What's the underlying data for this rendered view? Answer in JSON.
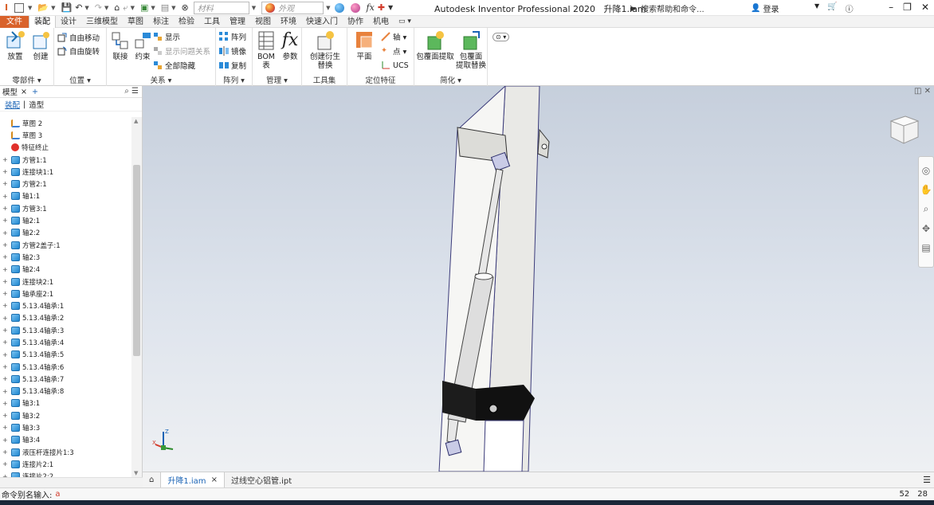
{
  "title_bar": {
    "app_title": "Autodesk Inventor Professional 2020",
    "document": "升降1.iam",
    "material_placeholder": "材料",
    "appearance_placeholder": "外观",
    "search_placeholder": "搜索帮助和命令...",
    "login": "登录"
  },
  "ribbon_tabs": [
    "文件",
    "装配",
    "设计",
    "三维模型",
    "草图",
    "标注",
    "检验",
    "工具",
    "管理",
    "视图",
    "环境",
    "快速入门",
    "协作",
    "机电"
  ],
  "active_tab": "装配",
  "ribbon": {
    "component": {
      "footer": "零部件 ▾",
      "place": "放置",
      "create": "创建"
    },
    "position": {
      "footer": "位置 ▾",
      "free_move": "自由移动",
      "free_rotate": "自由旋转"
    },
    "relationships": {
      "footer": "关系 ▾",
      "join": "联接",
      "constrain": "约束",
      "show": "显示",
      "show_problem": "显示问题关系",
      "hide_all": "全部隐藏"
    },
    "pattern": {
      "footer": "阵列 ▾",
      "pattern": "阵列",
      "mirror": "镜像",
      "copy": "复制"
    },
    "manage": {
      "footer": "管理 ▾",
      "bom_l1": "BOM",
      "bom_l2": "表",
      "params": "参数"
    },
    "productivity": {
      "footer": "工具集",
      "derive_l1": "创建衍生",
      "derive_l2": "替换"
    },
    "work_features": {
      "footer": "定位特征",
      "plane": "平面",
      "axis": "轴 ▾",
      "point": "点 ▾",
      "ucs": "UCS"
    },
    "simplification": {
      "footer": "简化 ▾",
      "shrinkwrap": "包覆面提取",
      "shrinkwrap_sub_l1": "包覆面",
      "shrinkwrap_sub_l2": "提取替换"
    }
  },
  "browser": {
    "header": "模型",
    "close": "×",
    "add": "+",
    "tab_assembly": "装配",
    "tab_modeling": "造型",
    "items": [
      {
        "label": "草图 2",
        "type": "sketch",
        "expand": false
      },
      {
        "label": "草图 3",
        "type": "sketch",
        "expand": false
      },
      {
        "label": "特征终止",
        "type": "stop",
        "expand": false
      },
      {
        "label": "方管1:1",
        "type": "part",
        "expand": true
      },
      {
        "label": "连接块1:1",
        "type": "part",
        "expand": true
      },
      {
        "label": "方管2:1",
        "type": "part",
        "expand": true
      },
      {
        "label": "轴1:1",
        "type": "part",
        "expand": true
      },
      {
        "label": "方管3:1",
        "type": "part",
        "expand": true
      },
      {
        "label": "轴2:1",
        "type": "part",
        "expand": true
      },
      {
        "label": "轴2:2",
        "type": "part",
        "expand": true
      },
      {
        "label": "方管2盖子:1",
        "type": "part",
        "expand": true
      },
      {
        "label": "轴2:3",
        "type": "part",
        "expand": true
      },
      {
        "label": "轴2:4",
        "type": "part",
        "expand": true
      },
      {
        "label": "连接块2:1",
        "type": "part",
        "expand": true
      },
      {
        "label": "轴承座2:1",
        "type": "part",
        "expand": true
      },
      {
        "label": "5.13.4轴承:1",
        "type": "part",
        "expand": true
      },
      {
        "label": "5.13.4轴承:2",
        "type": "part",
        "expand": true
      },
      {
        "label": "5.13.4轴承:3",
        "type": "part",
        "expand": true
      },
      {
        "label": "5.13.4轴承:4",
        "type": "part",
        "expand": true
      },
      {
        "label": "5.13.4轴承:5",
        "type": "part",
        "expand": true
      },
      {
        "label": "5.13.4轴承:6",
        "type": "part",
        "expand": true
      },
      {
        "label": "5.13.4轴承:7",
        "type": "part",
        "expand": true
      },
      {
        "label": "5.13.4轴承:8",
        "type": "part",
        "expand": true
      },
      {
        "label": "轴3:1",
        "type": "part",
        "expand": true
      },
      {
        "label": "轴3:2",
        "type": "part",
        "expand": true
      },
      {
        "label": "轴3:3",
        "type": "part",
        "expand": true
      },
      {
        "label": "轴3:4",
        "type": "part",
        "expand": true
      },
      {
        "label": "液压杆连接片1:3",
        "type": "part",
        "expand": true
      },
      {
        "label": "连接片2:1",
        "type": "part",
        "expand": true
      },
      {
        "label": "连接片2:2",
        "type": "part",
        "expand": true
      }
    ]
  },
  "doc_tabs": [
    {
      "label": "升降1.iam",
      "active": true,
      "close": "×"
    },
    {
      "label": "过线空心铝管.ipt",
      "active": false,
      "close": ""
    }
  ],
  "status": {
    "prompt": "命令别名输入:",
    "value": "a",
    "coord_x": "52",
    "coord_y": "28"
  },
  "viewport": {
    "triad_z": "Z",
    "triad_x": "X"
  },
  "colors": {
    "file_tab": "#d9622b",
    "accent": "#1a63b5",
    "part_icon": "#1f87d0",
    "viewport_top": "#c6cfdc"
  }
}
